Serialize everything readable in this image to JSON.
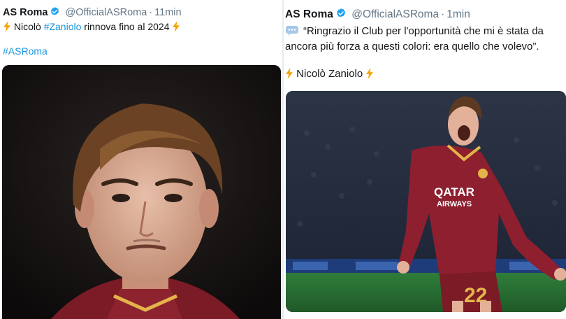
{
  "left_tweet": {
    "display_name": "AS Roma",
    "handle": "@OfficialASRoma",
    "separator": "·",
    "timestamp": "11min",
    "text_prefix": "Nicolò",
    "text_hashtag": "#Zaniolo",
    "text_suffix": "rinnova fino al 2024",
    "hashtag_line": "#ASRoma",
    "media_icon": "portrait-photo"
  },
  "right_tweet": {
    "display_name": "AS Roma",
    "handle": "@OfficialASRoma",
    "separator": "·",
    "timestamp": "1min",
    "quote_line_1": "“Ringrazio il Club per l'opportunità che mi è stata da",
    "quote_line_2": "ancora più forza a questi colori: era quello che volevo”.",
    "signature": "Nicolò Zaniolo",
    "media_icon": "celebration-photo",
    "jersey_sponsor_1": "QATAR",
    "jersey_sponsor_2": "AIRWAYS",
    "jersey_number": "22"
  },
  "colors": {
    "text": "#14171a",
    "muted": "#657786",
    "link": "#1b95e0",
    "verified": "#1da1f2",
    "bolt": "#f4a400",
    "roma_red": "#8e1f2f"
  }
}
